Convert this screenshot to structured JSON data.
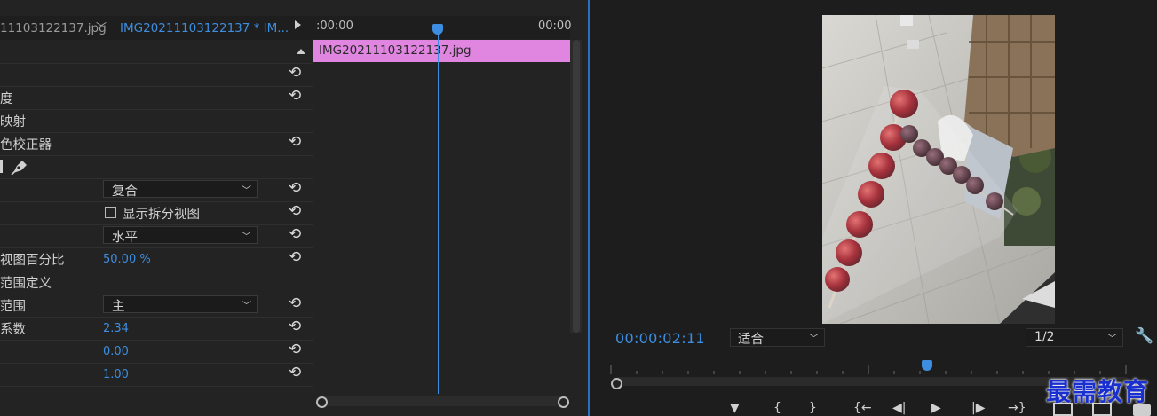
{
  "effect_controls": {
    "source_clip_name": "11103122137.jpg",
    "sequence_clip_name": "IMG20211103122137 * IM...",
    "rows": [
      {
        "label": ""
      },
      {
        "label": "度"
      },
      {
        "label": "映射"
      },
      {
        "label": "色校正器"
      },
      {
        "label": ""
      },
      {
        "label": "",
        "dropdown": "复合"
      },
      {
        "label": "",
        "checkbox_label": "显示拆分视图"
      },
      {
        "label": "",
        "dropdown": "水平"
      },
      {
        "label": "视图百分比",
        "value": "50.00 %"
      },
      {
        "label": "范围定义"
      },
      {
        "label": "范围",
        "dropdown": "主"
      },
      {
        "label": "系数",
        "value": "2.34"
      },
      {
        "label": "",
        "value": "0.00"
      },
      {
        "label": "",
        "value": "1.00"
      }
    ],
    "reset_glyph": "⟲",
    "mini_timeline": {
      "start_time": ":00:00",
      "end_time": "00:00",
      "clip_label": "IMG20211103122137.jpg"
    }
  },
  "program_monitor": {
    "timecode": "00:00:02:11",
    "fit_option": "适合",
    "resolution": "1/2",
    "transport": {
      "marker": "▼",
      "mark_in": "{",
      "mark_out": "}",
      "go_to_in": "{←",
      "step_back": "◀|",
      "play": "▶",
      "step_forward": "|▶",
      "go_to_out": "→}"
    }
  },
  "watermark": "最需教育",
  "colors": {
    "accent_blue": "#3d8ee0",
    "clip_pink": "#e085e0",
    "panel_bg": "#232323",
    "watermark_blue": "#1a2fd0"
  }
}
